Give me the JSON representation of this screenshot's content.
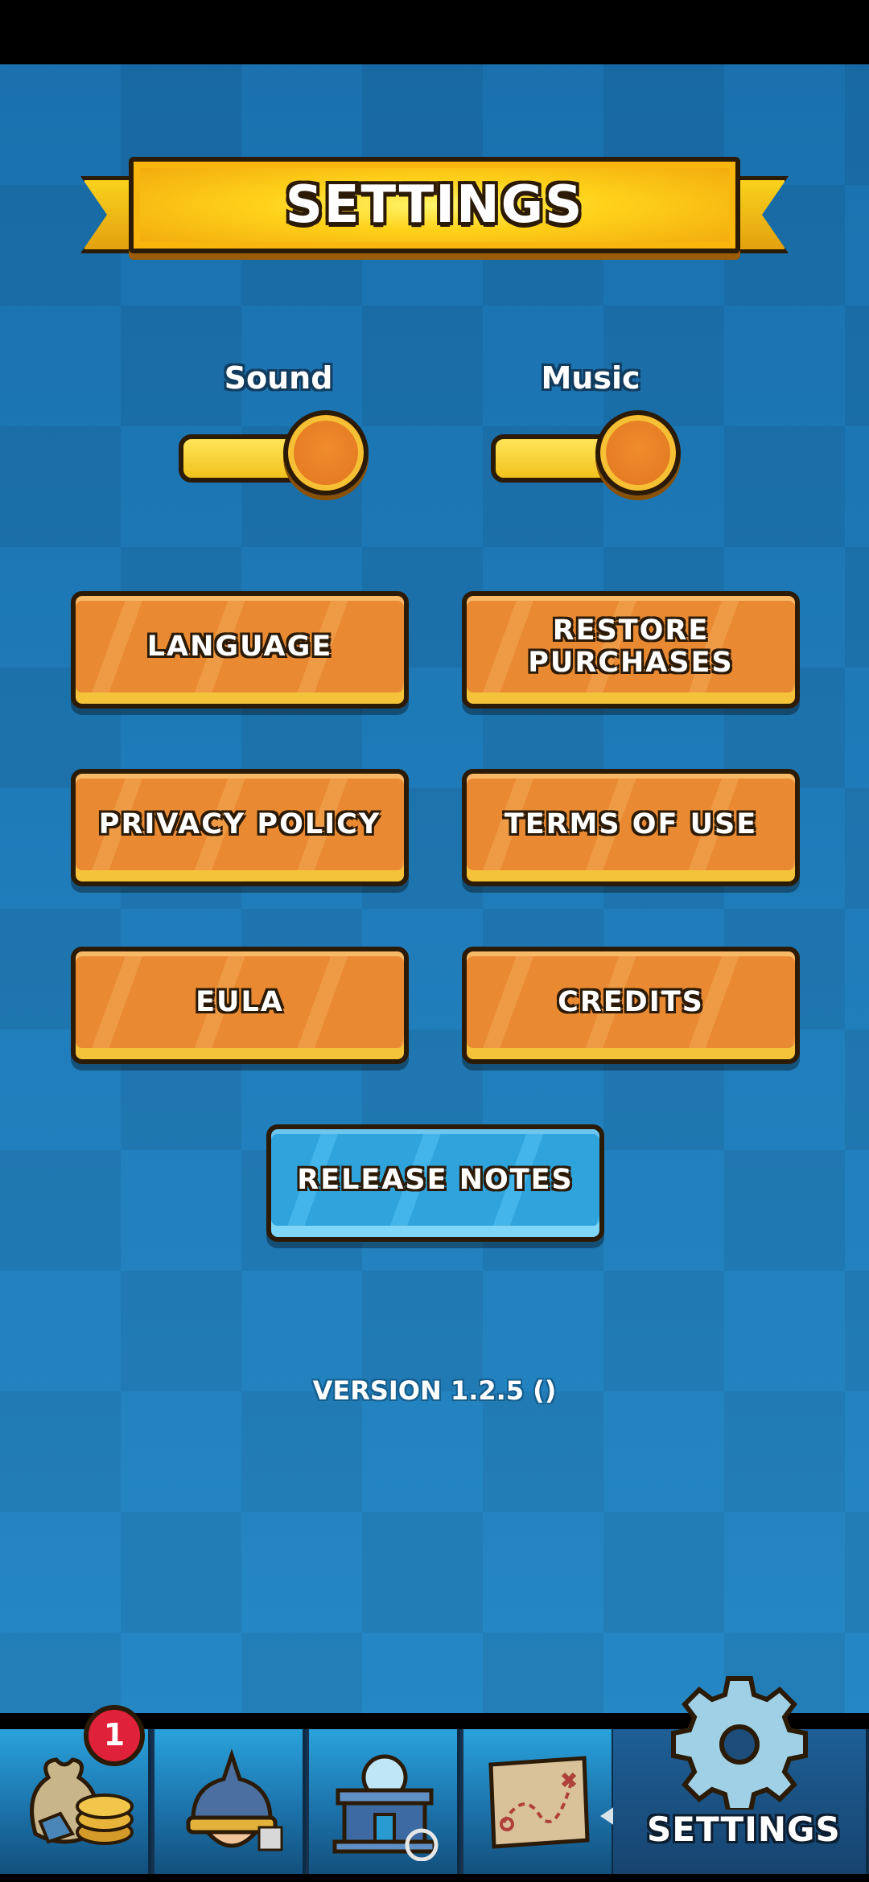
{
  "header": {
    "title": "SETTINGS"
  },
  "toggles": {
    "sound": {
      "label": "Sound",
      "on": true
    },
    "music": {
      "label": "Music",
      "on": true
    }
  },
  "buttons": {
    "language": "LANGUAGE",
    "restore_purchases": [
      "RESTORE",
      "PURCHASES"
    ],
    "privacy_policy": "PRIVACY POLICY",
    "terms_of_use": "TERMS OF USE",
    "eula": "EULA",
    "credits": "CREDITS",
    "release_notes": "RELEASE NOTES"
  },
  "version": "VERSION 1.2.5 ()",
  "bottom_nav": {
    "badge_count": "1",
    "items": [
      {
        "icon": "treasure-bag-icon"
      },
      {
        "icon": "helmet-icon"
      },
      {
        "icon": "museum-icon"
      },
      {
        "icon": "treasure-map-icon"
      },
      {
        "icon": "gear-icon",
        "label": "SETTINGS",
        "active": true
      }
    ]
  },
  "colors": {
    "background": "#1f7fbd",
    "button_orange": "#e98a32",
    "button_blue": "#2ea3dc",
    "banner_gold": "#ffd21a",
    "badge_red": "#e0213a"
  }
}
